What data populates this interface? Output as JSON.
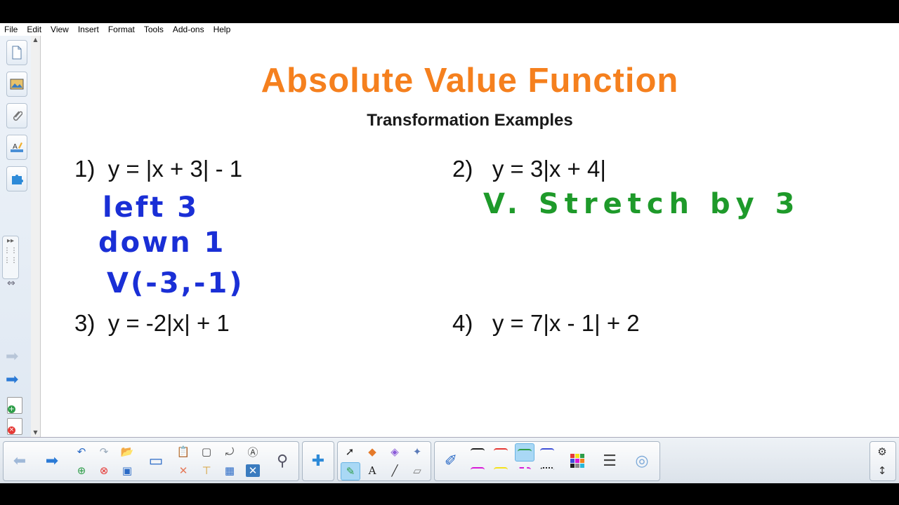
{
  "menu": [
    "File",
    "Edit",
    "View",
    "Insert",
    "Format",
    "Tools",
    "Add-ons",
    "Help"
  ],
  "slide": {
    "title": "Absolute Value Function",
    "subtitle": "Transformation Examples",
    "problems": [
      {
        "label": "1)",
        "equation": "y = |x + 3| - 1"
      },
      {
        "label": "2)",
        "equation": "y = 3|x + 4|"
      },
      {
        "label": "3)",
        "equation": "y = -2|x| + 1"
      },
      {
        "label": "4)",
        "equation": "y = 7|x - 1| + 2"
      }
    ],
    "handwriting": {
      "p1_line1": "left 3",
      "p1_line2": "down 1",
      "p1_line3": "V(-3,-1)",
      "p2_line1": "V. Stretch by 3",
      "blue": "#1a2fd6",
      "green": "#1e9a2a"
    }
  },
  "colors": {
    "title": "#f5801e",
    "pen_black": "#222222",
    "pen_red": "#e53935",
    "pen_green": "#2e9d48",
    "pen_blue": "#3f51d8",
    "pen_magenta": "#d81bd8",
    "pen_yellow": "#f4e21c"
  },
  "icons": {
    "sidebar": [
      "page-sorter-icon",
      "gallery-icon",
      "attachments-icon",
      "properties-icon",
      "addons-icon"
    ],
    "toolbar": [
      "previous-page-icon",
      "next-page-icon",
      "undo-icon",
      "redo-icon",
      "open-icon",
      "screen-shade-icon",
      "paste-icon",
      "camera-icon",
      "rotate-icon",
      "recognize-icon",
      "add-page-icon",
      "delete-page-icon",
      "save-icon",
      "delete-icon",
      "table-icon",
      "clear-icon",
      "document-camera-icon",
      "puzzle-icon",
      "select-icon",
      "fill-icon",
      "eraser-icon",
      "magic-pen-icon",
      "pen-icon",
      "text-icon",
      "line-icon",
      "shape-eraser-icon",
      "color-palette-icon",
      "line-style-icon",
      "transparency-icon",
      "settings-icon",
      "toolbar-move-icon"
    ]
  }
}
